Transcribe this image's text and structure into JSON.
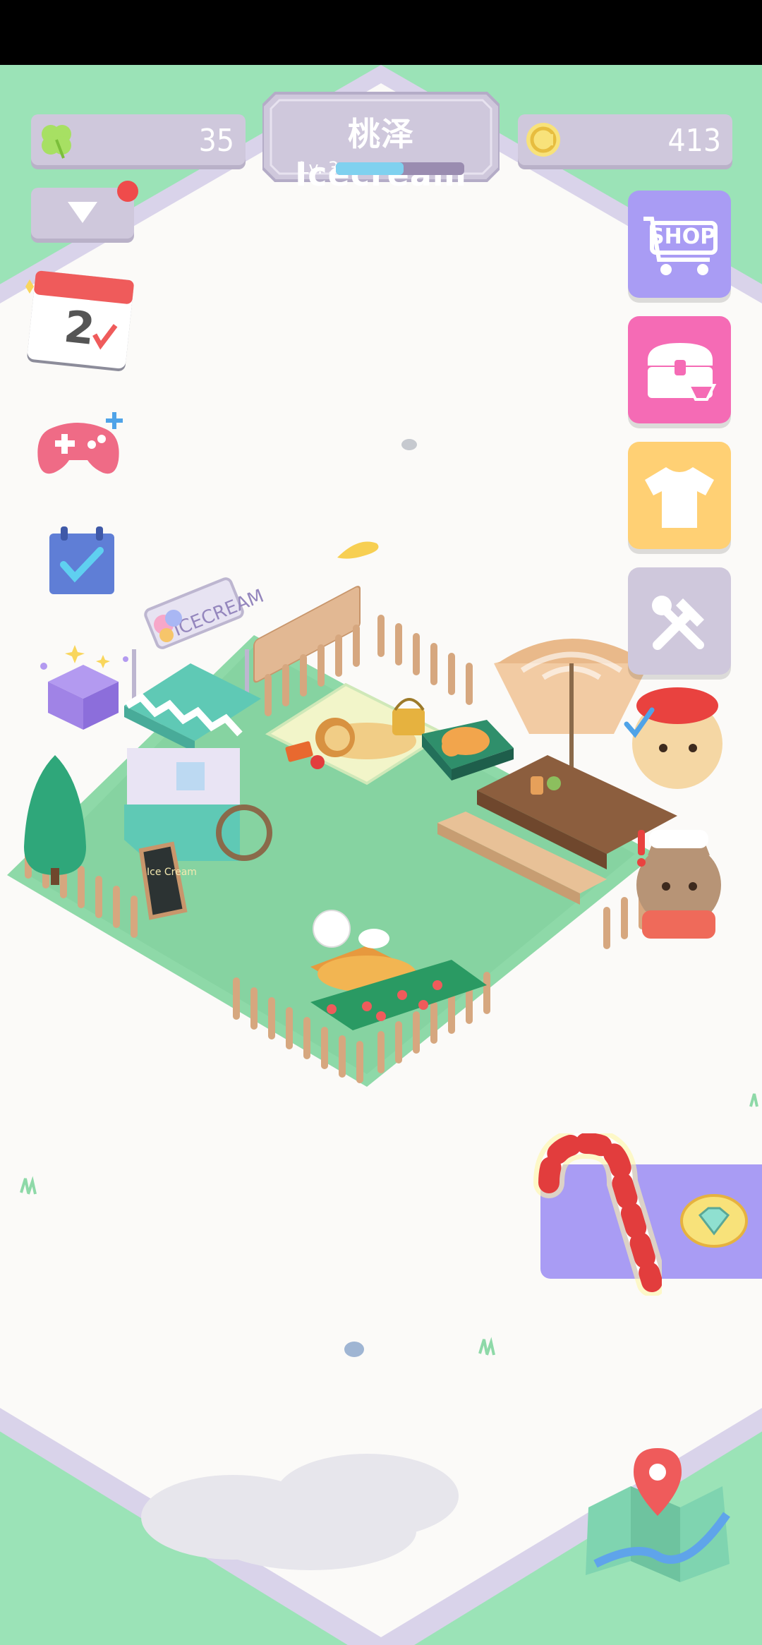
{
  "hud": {
    "clover_count": "35",
    "coin_count": "413",
    "player_name": "桃泽 Icecream",
    "level_label": "Lv. 3",
    "xp_progress": 0.53
  },
  "side_buttons": {
    "shop_label": "SHOP"
  },
  "colors": {
    "grass_border": "#9be3b7",
    "field": "#fbfaf8",
    "garden": "#8ed9a8",
    "hud_pill": "#cfc8dc",
    "shop": "#a99cf4",
    "chest": "#f56bb5",
    "shirt": "#ffd074",
    "tools": "#cfc8dc"
  },
  "icons": [
    "clover-icon",
    "coin-icon",
    "dropdown-arrow-icon",
    "calendar-icon",
    "gamepad-icon",
    "checklist-icon",
    "gift-box-icon",
    "shop-cart-icon",
    "treasure-chest-icon",
    "tshirt-icon",
    "tools-icon",
    "candy-cane-icon",
    "diamond-icon",
    "map-icon"
  ],
  "scene": {
    "cart_sign": "ICECREAM",
    "board_text": "Ice Cream"
  }
}
